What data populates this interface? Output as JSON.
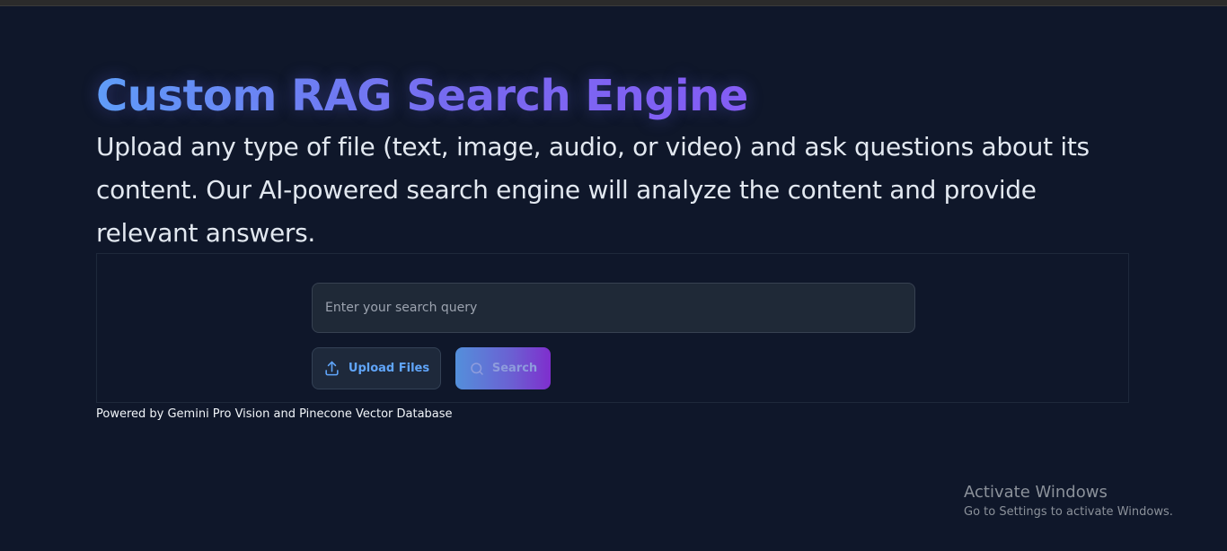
{
  "header": {
    "title": "Custom RAG Search Engine",
    "description": "Upload any type of file (text, image, audio, or video) and ask questions about its content. Our AI-powered search engine will analyze the content and provide relevant answers."
  },
  "search": {
    "placeholder": "Enter your search query",
    "value": ""
  },
  "actions": {
    "upload_label": "Upload Files",
    "upload_icon": "upload-icon",
    "search_label": "Search",
    "search_icon": "search-icon"
  },
  "footer": {
    "text": "Powered by Gemini Pro Vision and Pinecone Vector Database"
  },
  "watermark": {
    "title": "Activate Windows",
    "subtitle": "Go to Settings to activate Windows."
  },
  "colors": {
    "background": "#0f172a",
    "title_gradient_start": "#60a5fa",
    "title_gradient_end": "#8b5cf6",
    "upload_text": "#60a5fa",
    "search_gradient_start": "#60a5fa",
    "search_gradient_end": "#9333ea"
  }
}
